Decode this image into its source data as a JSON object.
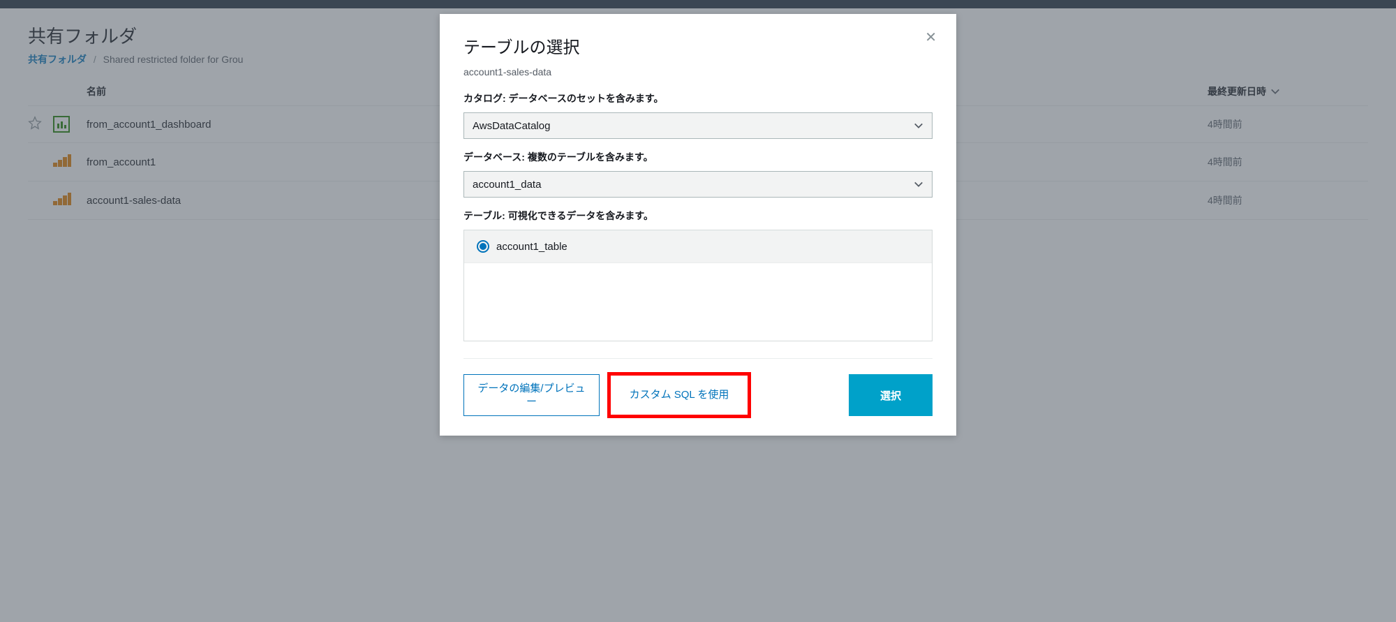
{
  "page": {
    "title": "共有フォルダ",
    "breadcrumb_root": "共有フォルダ",
    "breadcrumb_current": "Shared restricted folder for Grou"
  },
  "list": {
    "header_name": "名前",
    "header_updated": "最終更新日時",
    "rows": [
      {
        "type": "dashboard",
        "name": "from_account1_dashboard",
        "updated": "4時間前"
      },
      {
        "type": "dataset",
        "name": "from_account1",
        "updated": "4時間前"
      },
      {
        "type": "dataset",
        "name": "account1-sales-data",
        "updated": "4時間前"
      }
    ]
  },
  "modal": {
    "title": "テーブルの選択",
    "subtitle": "account1-sales-data",
    "catalog_label": "カタログ: データベースのセットを含みます。",
    "catalog_value": "AwsDataCatalog",
    "database_label": "データベース: 複数のテーブルを含みます。",
    "database_value": "account1_data",
    "tables_label": "テーブル: 可視化できるデータを含みます。",
    "tables": [
      {
        "name": "account1_table",
        "selected": true
      }
    ],
    "footer": {
      "edit_preview": "データの編集/プレビュー",
      "custom_sql": "カスタム SQL を使用",
      "select": "選択"
    }
  }
}
